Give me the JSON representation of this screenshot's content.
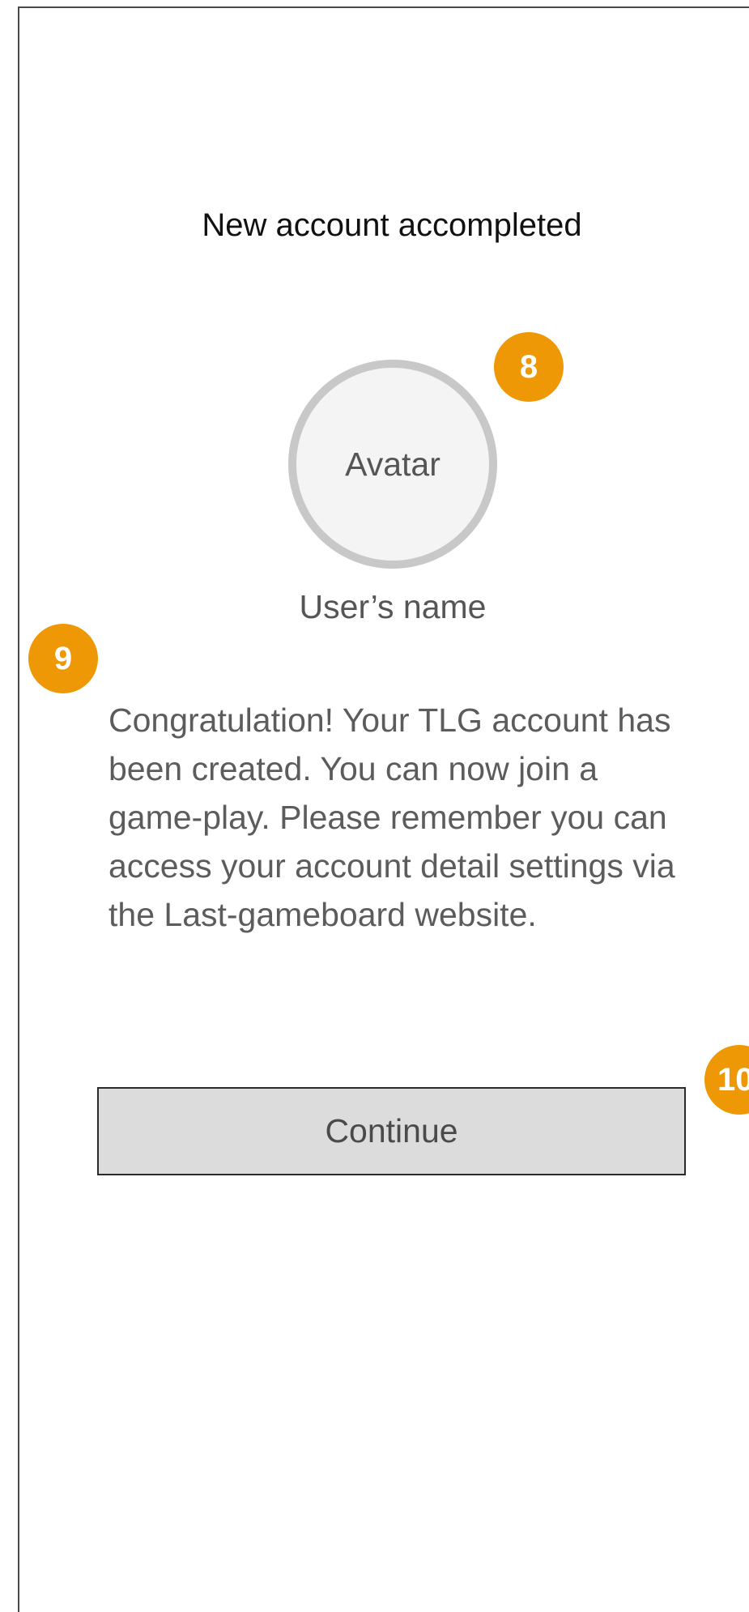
{
  "header": {
    "title": "New account accompleted"
  },
  "profile": {
    "avatar_label": "Avatar",
    "user_name": "User’s name"
  },
  "message": {
    "text": "Congratulation! Your TLG account has been created. You can now join a game-play. Please remember you can access your account detail settings via the Last-gameboard website."
  },
  "actions": {
    "continue_label": "Continue"
  },
  "annotations": {
    "marker_8": "8",
    "marker_9": "9",
    "marker_10": "10"
  },
  "colors": {
    "marker": "#ee9806",
    "button_bg": "#dcdcdc",
    "avatar_ring": "#c8c8c8",
    "avatar_fill": "#f4f4f4"
  }
}
